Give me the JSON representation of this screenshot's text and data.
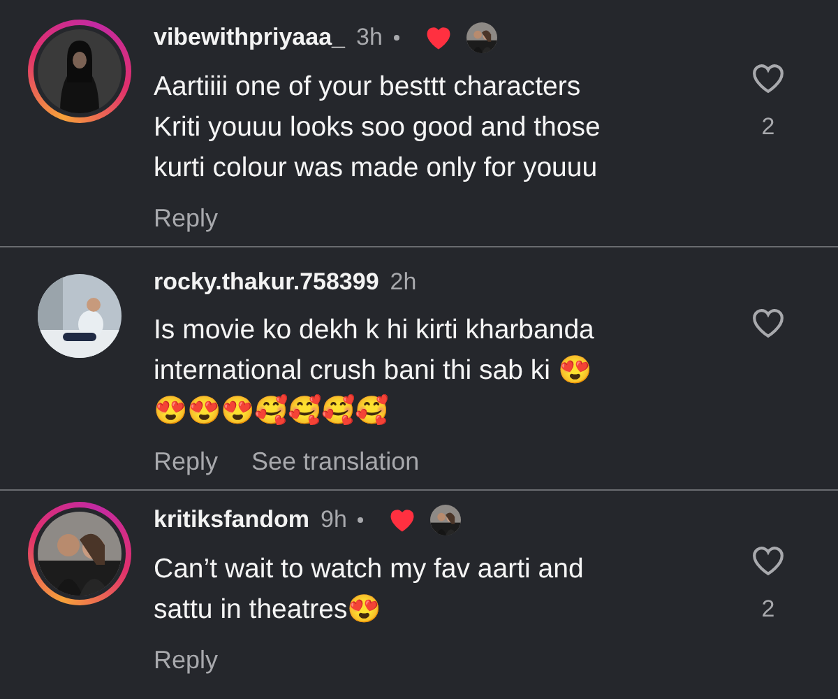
{
  "comments": [
    {
      "username": "vibewithpriyaaa_",
      "time": "3h",
      "story_ring": true,
      "author_liked": true,
      "body_lines": [
        "Aartiiii one of your besttt characters",
        "Kriti youuu looks soo good and those",
        "kurti colour was made only for youuu"
      ],
      "actions": [
        "Reply"
      ],
      "like_count": "2"
    },
    {
      "username": "rocky.thakur.758399",
      "time": "2h",
      "story_ring": false,
      "author_liked": false,
      "body_lines": [
        "Is movie ko dekh k hi kirti kharbanda",
        "international crush bani thi sab ki 😍",
        "😍😍😍🥰🥰🥰🥰"
      ],
      "actions": [
        "Reply",
        "See translation"
      ]
    },
    {
      "username": "kritiksfandom",
      "time": "9h",
      "story_ring": true,
      "author_liked": true,
      "body_lines": [
        "Can’t wait to watch my fav aarti and",
        "sattu in theatres😍"
      ],
      "actions": [
        "Reply"
      ],
      "like_count": "2"
    }
  ]
}
